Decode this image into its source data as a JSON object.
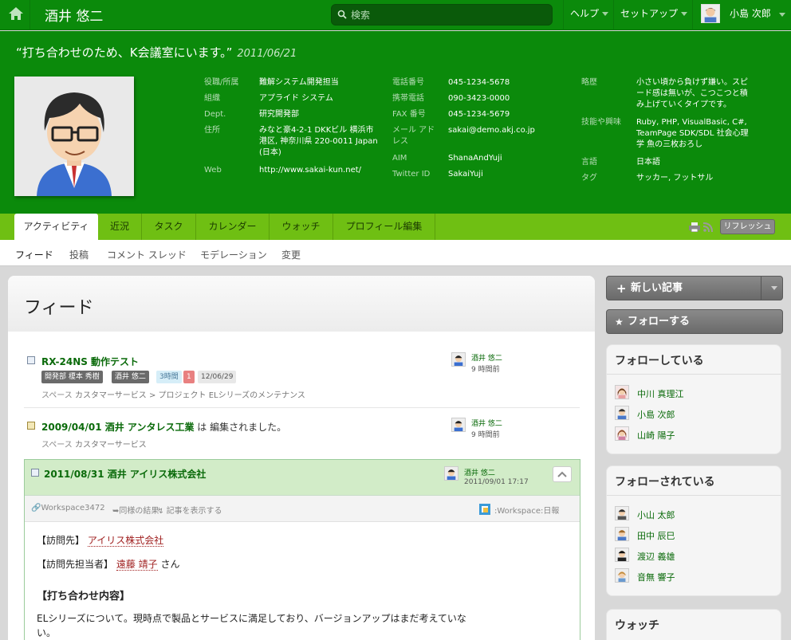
{
  "topbar": {
    "page_title": "酒井 悠二",
    "search_placeholder": "検索",
    "help": "ヘルプ",
    "setup": "セットアップ",
    "user": "小島 次郎"
  },
  "profile": {
    "status": "“打ち合わせのため、K会議室にいます。”",
    "status_date": "2011/06/21",
    "col1": [
      {
        "label": "役職/所属",
        "value": "難解システム開発担当"
      },
      {
        "label": "組織",
        "value": "アプライド システム"
      },
      {
        "label": "Dept.",
        "value": "研究開発部"
      },
      {
        "label": "住所",
        "value": "みなと豪4-2-1 DKKビル 横浜市港区, 神奈川県 220-0011 Japan (日本)"
      },
      {
        "label": "Web",
        "value": "http://www.sakai-kun.net/"
      }
    ],
    "col2": [
      {
        "label": "電話番号",
        "value": "045-1234-5678"
      },
      {
        "label": "携帯電話",
        "value": "090-3423-0000"
      },
      {
        "label": "FAX 番号",
        "value": "045-1234-5679"
      },
      {
        "label": "メール アドレス",
        "value": "sakai@demo.akj.co.jp"
      },
      {
        "label": "AIM",
        "value": "ShanaAndYuji"
      },
      {
        "label": "Twitter ID",
        "value": "SakaiYuji"
      }
    ],
    "col3": [
      {
        "label": "略歴",
        "value": "小さい頃から負けず嫌い。スピード感は無いが、こつこつと積み上げていくタイプです。"
      },
      {
        "label": "技能や興味",
        "value": "Ruby, PHP, VisualBasic, C#, TeamPage SDK/SDL 社会心理学 魚の三枚おろし"
      },
      {
        "label": "言語",
        "value": "日本語"
      },
      {
        "label": "タグ",
        "value": "サッカー, フットサル"
      }
    ]
  },
  "tabs": [
    "アクティビティ",
    "近況",
    "タスク",
    "カレンダー",
    "ウォッチ",
    "プロフィール編集"
  ],
  "refresh": "リフレッシュ",
  "subtabs": [
    "フィード",
    "投稿",
    "コメント スレッド",
    "モデレーション",
    "変更"
  ],
  "feed": {
    "title": "フィード",
    "items": [
      {
        "title": "RX-24NS 動作テスト",
        "badges": [
          "開発部 榎本 秀樹",
          "酒井 悠二",
          "3時間",
          "1",
          "12/06/29"
        ],
        "meta_prefix": "スペース",
        "meta_path": "カスタマーサービス > プロジェクト ELシリーズのメンテナンス",
        "author": "酒井 悠二",
        "time": "9 時間前"
      },
      {
        "title": "2009/04/01 酒井 アンタレス工業",
        "title_suffix": "は 編集されました。",
        "meta_prefix": "スペース",
        "meta_path": "カスタマーサービス",
        "author": "酒井 悠二",
        "time": "9 時間前"
      },
      {
        "title": "2011/08/31 酒井 アイリス株式会社",
        "author": "酒井 悠二",
        "time": "2011/09/01 17:17",
        "bar_links": [
          "Workspace3472",
          "同様の結果",
          "記事を表示する"
        ],
        "workspace": ":Workspace:日報",
        "visit_label": "【訪問先】",
        "visit_value": "アイリス株式会社",
        "contact_label": "【訪問先担当者】",
        "contact_value": "遠藤 靖子",
        "contact_suffix": "さん",
        "section": "【打ち合わせ内容】",
        "body": "ELシリーズについて。現時点で製品とサービスに満足しており、バージョンアップはまだ考えていない。"
      }
    ]
  },
  "sidebar": {
    "new_post": "新しい記事",
    "follow": "フォローする",
    "following_title": "フォローしている",
    "following": [
      "中川 真理江",
      "小島 次郎",
      "山崎 陽子"
    ],
    "followers_title": "フォローされている",
    "followers": [
      "小山 太郎",
      "田中 辰巳",
      "渡辺 義雄",
      "音無 響子"
    ],
    "watch_title": "ウォッチ"
  },
  "colors": {
    "brand": "#0b8a0b",
    "tabbar": "#6fbf13",
    "link": "#0a6a0a"
  }
}
